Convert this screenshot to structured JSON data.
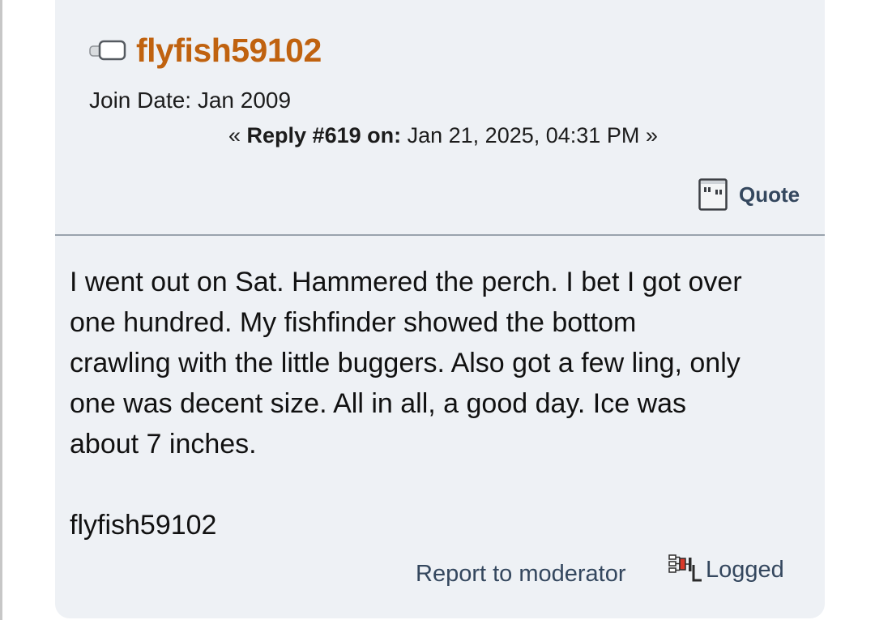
{
  "post": {
    "author": "flyfish59102",
    "join_date": "Join Date: Jan 2009",
    "reply_prefix": "« ",
    "reply_label": "Reply #619 on:",
    "reply_date": " Jan 21, 2025, 04:31 PM »",
    "quote_label": "Quote",
    "body_lines": [
      "I went out on Sat. Hammered the perch. I bet I got over",
      "one hundred. My fishfinder showed the bottom",
      "crawling with the little buggers. Also got a few ling, only",
      "one was decent size. All in all, a good day. Ice was",
      "about 7 inches."
    ],
    "signature": "flyfish59102",
    "report_label": "Report to moderator",
    "logged_label": "Logged"
  },
  "colors": {
    "author": "#c0620f",
    "link": "#34475e",
    "card_bg": "#eef1f5"
  },
  "icons": {
    "status": "offline-status-icon",
    "quote": "quote-icon",
    "ip": "ip-logged-icon"
  }
}
